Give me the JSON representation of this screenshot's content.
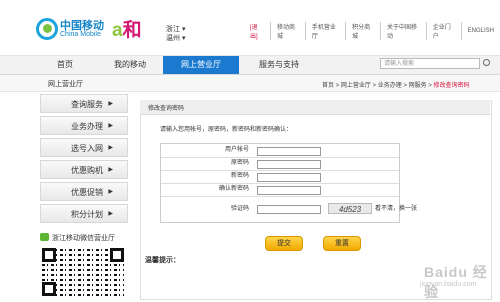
{
  "brand": {
    "name_cn": "中国移动",
    "name_en": "China Mobile",
    "sub_mark": "和",
    "province": "浙江",
    "city": "温州"
  },
  "topbar": {
    "links": [
      "[退出]",
      "移动商城",
      "手机营业厅",
      "积分商城",
      "关于中国移动",
      "企业门户",
      "ENGLISH"
    ]
  },
  "nav": {
    "items": [
      "首页",
      "我的移动",
      "网上营业厅",
      "服务与支持"
    ],
    "active": "网上营业厅",
    "search_placeholder": "请输入搜索"
  },
  "breadcrumb": {
    "section_title": "网上营业厅",
    "items": [
      "首页",
      "网上营业厅",
      "业务办理",
      "网服务",
      "修改查询密码"
    ]
  },
  "sidebar": {
    "items": [
      "查询服务",
      "业务办理",
      "选号入网",
      "优惠购机",
      "优惠促销",
      "积分计划"
    ],
    "arrow": "▶"
  },
  "wechat": {
    "label": "浙江移动微信营业厅"
  },
  "panel": {
    "title": "修改查询密码",
    "instruction": "请输入您用帐号，原密码，新密码和新密码确认：",
    "fields": [
      "用户帐号",
      "原密码",
      "新密码",
      "确认新密码",
      "验证码"
    ],
    "captcha_text": "4d523",
    "captcha_refresh": "看不清，换一张",
    "submit_label": "提交",
    "reset_label": "重置",
    "tips_label": "温馨提示："
  },
  "watermark": {
    "main": "Baidu 经验",
    "sub": "jingyan.baidu.com"
  },
  "colors": {
    "nav_active": "#1b7ad0",
    "brand_blue": "#1485c8",
    "button_yellow": "#f2a900",
    "link_red": "#d0103a"
  }
}
